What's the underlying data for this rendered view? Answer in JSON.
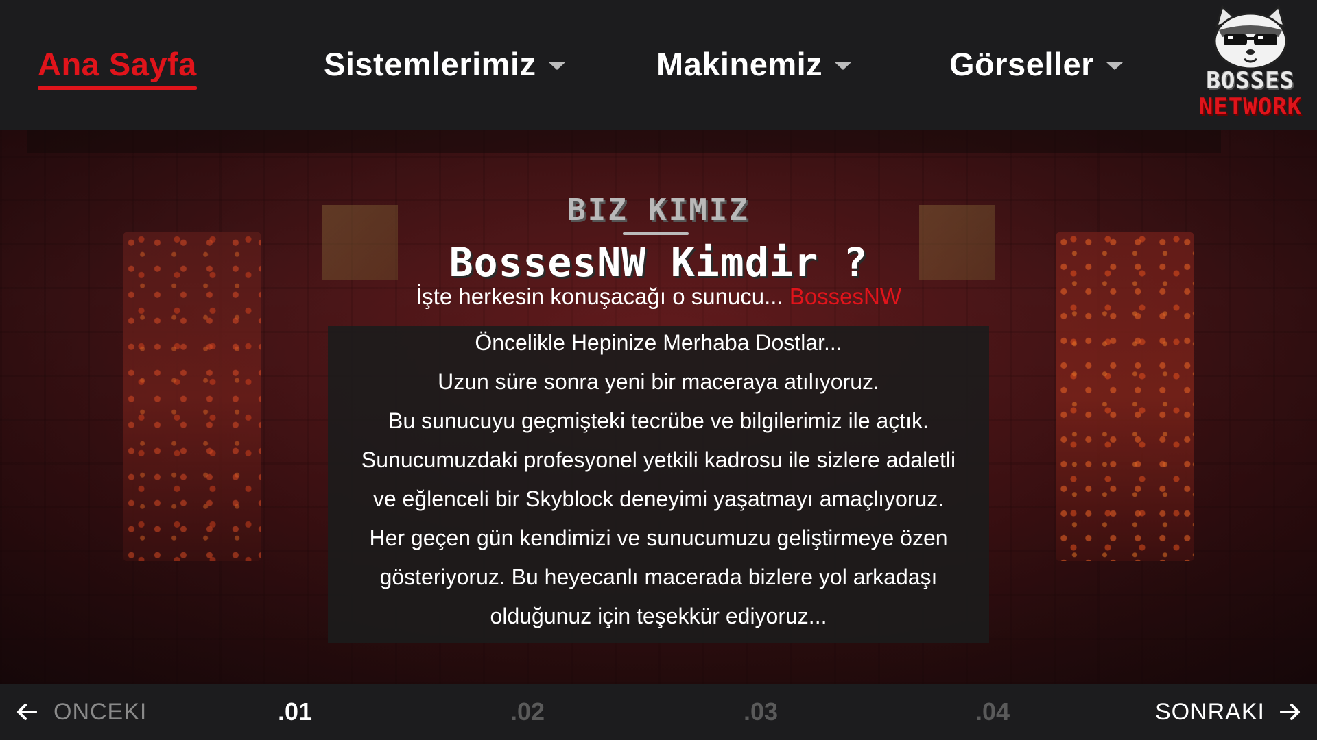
{
  "nav": {
    "items": [
      {
        "label": "Ana Sayfa",
        "active": true
      },
      {
        "label": "Sistemlerimiz",
        "dropdown": true
      },
      {
        "label": "Makinemiz",
        "dropdown": true
      },
      {
        "label": "Görseller",
        "dropdown": true
      }
    ],
    "logo": {
      "line1": "BOSSES",
      "line2": "NETWORK",
      "icon": "raccoon-sunglasses-icon"
    }
  },
  "hero": {
    "section_label": "BIZ KIMIZ",
    "heading": "BossesNW Kimdir ?",
    "tagline_text": "İşte herkesin konuşacağı o sunucu...",
    "tagline_accent": "BossesNW",
    "about_lines": [
      "Öncelikle Hepinize Merhaba Dostlar...",
      "Uzun süre sonra yeni bir maceraya atılıyoruz.",
      "Bu sunucuyu geçmişteki tecrübe ve bilgilerimiz ile açtık.",
      "Sunucumuzdaki profesyonel yetkili kadrosu ile sizlere adaletli",
      "ve eğlenceli bir Skyblock deneyimi yaşatmayı amaçlıyoruz.",
      "Her geçen gün kendimizi ve sunucumuzu geliştirmeye özen",
      "gösteriyoruz. Bu heyecanlı macerada bizlere yol arkadaşı",
      "olduğunuz için teşekkür ediyoruz..."
    ]
  },
  "footer": {
    "prev_label": "ONCEKI",
    "next_label": "SONRAKI",
    "pages": [
      ".01",
      ".02",
      ".03",
      ".04"
    ],
    "active_page": ".01"
  },
  "colors": {
    "accent": "#e0141b",
    "nav_bg": "#1c1c1e",
    "text": "#ffffff"
  }
}
